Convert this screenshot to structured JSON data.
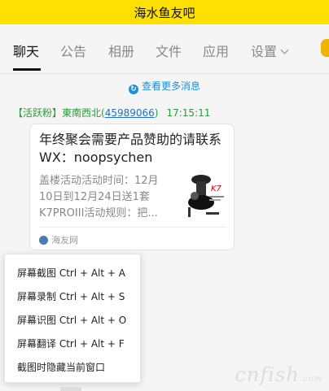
{
  "window": {
    "title": "海水鱼友吧"
  },
  "tabs": [
    {
      "label": "聊天",
      "active": true
    },
    {
      "label": "公告"
    },
    {
      "label": "相册"
    },
    {
      "label": "文件"
    },
    {
      "label": "应用"
    },
    {
      "label": "设置"
    }
  ],
  "chat": {
    "more_messages": "查看更多消息",
    "sender_badge": "【活跃粉】",
    "sender_name": "東南西北",
    "sender_uid": "45989066",
    "time": "17:15:11",
    "card": {
      "title": "年终聚会需要产品赞助的请联系WX：noopsychen",
      "description": "盖楼活动活动时间：12月10日到12月24日送1套K7PROIII活动规则：把...",
      "source": "海友网"
    }
  },
  "context_menu": {
    "items": [
      "屏幕截图 Ctrl + Alt + A",
      "屏幕录制 Ctrl + Alt + S",
      "屏幕识图 Ctrl + Alt + O",
      "屏幕翻译 Ctrl + Alt + F",
      "截图时隐藏当前窗口"
    ]
  },
  "watermark": {
    "text": "cnfish",
    "suffix": ".com"
  },
  "colors": {
    "title_bar": "#ffe000",
    "link_blue": "#1e90d6",
    "sender_green": "#2a9a3a"
  },
  "icons": [
    "info-icon",
    "chevron-down-icon",
    "source-icon",
    "product-thumbnail"
  ]
}
